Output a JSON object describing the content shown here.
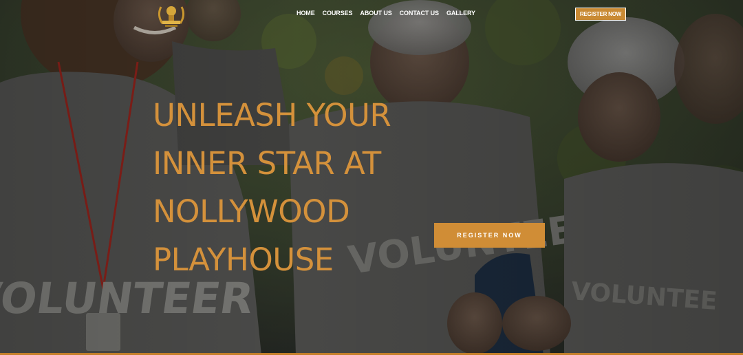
{
  "brand": {
    "logo_icon": "laurel-trophy-icon"
  },
  "nav": {
    "items": [
      {
        "label": "HOME"
      },
      {
        "label": "COURSES"
      },
      {
        "label": "ABOUT US"
      },
      {
        "label": "CONTACT US"
      },
      {
        "label": "GALLERY"
      }
    ]
  },
  "header": {
    "register_label": "REGISTER NOW"
  },
  "hero": {
    "headline_lines": [
      "UNLEASH YOUR",
      "INNER STAR AT",
      "NOLLYWOOD",
      "PLAYHOUSE"
    ],
    "cta_label": "REGISTER NOW",
    "background_alt": "volunteers in grey volunteer t-shirts"
  },
  "colors": {
    "accent": "#d08d36",
    "headline": "#d4913b",
    "nav_text": "#ffffff"
  }
}
